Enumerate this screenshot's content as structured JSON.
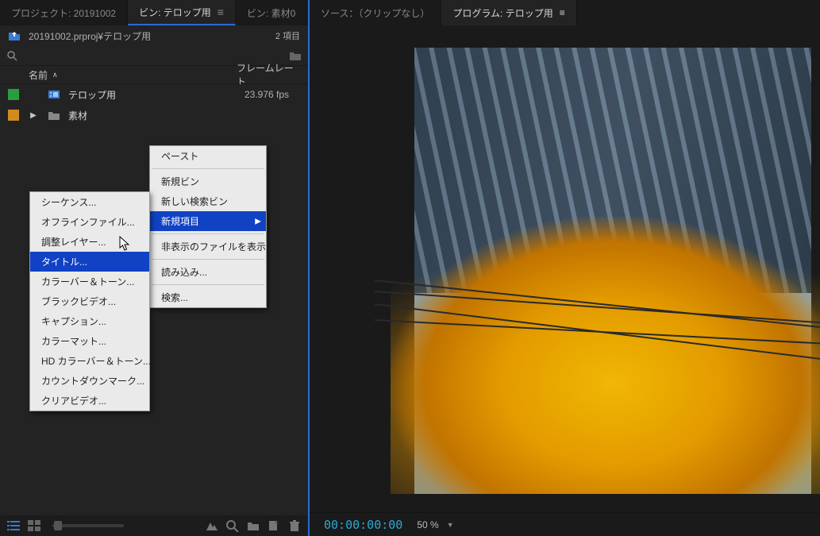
{
  "leftTabs": {
    "project": "プロジェクト: 20191002",
    "binActive": "ビン: テロップ用",
    "binOther": "ビン: 素材0"
  },
  "breadcrumb": {
    "path": "20191002.prproj¥テロップ用",
    "itemCount": "2 項目"
  },
  "search": {
    "placeholder": ""
  },
  "columns": {
    "name": "名前",
    "frameRate": "フレームレート"
  },
  "rows": [
    {
      "label": "テロップ用",
      "rate": "23.976 fps"
    },
    {
      "label": "素材",
      "rate": ""
    }
  ],
  "rightTabs": {
    "source": "ソース：（クリップなし）",
    "program": "プログラム: テロップ用"
  },
  "contextMenuMain": {
    "paste": "ペースト",
    "newBin": "新規ビン",
    "newSearchBin": "新しい検索ビン",
    "newItem": "新規項目",
    "showHidden": "非表示のファイルを表示",
    "import": "読み込み...",
    "search": "検索..."
  },
  "contextMenuSub": {
    "sequence": "シーケンス...",
    "offlineFile": "オフラインファイル...",
    "adjustmentLayer": "調整レイヤー...",
    "title": "タイトル...",
    "colorBarsTone": "カラーバー＆トーン...",
    "blackVideo": "ブラックビデオ...",
    "caption": "キャプション...",
    "colorMatte": "カラーマット...",
    "hdColorBarsTone": "HD カラーバー＆トーン...",
    "countdown": "カウントダウンマーク...",
    "clearVideo": "クリアビデオ..."
  },
  "programFooter": {
    "timecode": "00:00:00:00",
    "zoom": "50 %"
  }
}
